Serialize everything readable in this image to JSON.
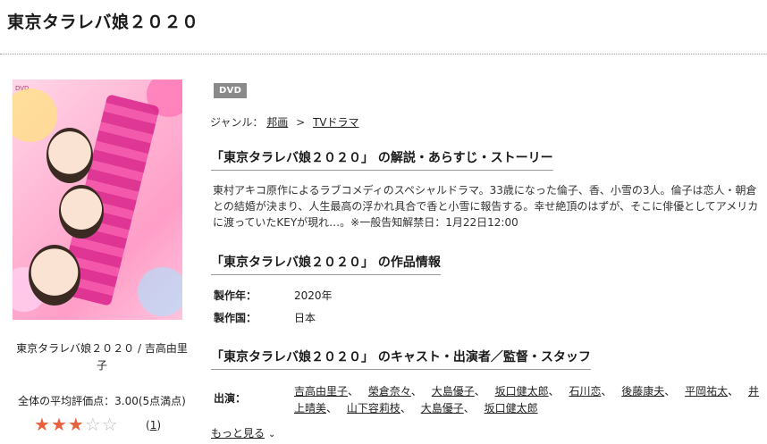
{
  "page_title": "東京タラレバ娘２０２０",
  "poster": {
    "caption": "東京タラレバ娘２０２０ / 吉高由里子",
    "average_rating_text": "全体の平均評価点：3.00(5点満点)",
    "rating": 3,
    "rating_max": 5,
    "review_count": "1"
  },
  "colors": {
    "star_on": "#e8603c",
    "star_off": "#bfbfbf",
    "badge_bg": "#8a8a8a",
    "poster_pink": "#ff9ec8"
  },
  "badge": "DVD",
  "breadcrumb": {
    "label": "ジャンル：",
    "items": [
      "邦画",
      "TVドラマ"
    ],
    "separator": ">"
  },
  "sections": {
    "story_heading": "「東京タラレバ娘２０２０」 の解説・あらすじ・ストーリー",
    "story_text": "東村アキコ原作によるラブコメディのスペシャルドラマ。33歳になった倫子、香、小雪の3人。倫子は恋人・朝倉との結婚が決まり、人生最高の浮かれ具合で香と小雪に報告する。幸せ絶頂のはずが、そこに俳優としてアメリカに渡っていたKEYが現れ…。※一般告知解禁日：1月22日12:00",
    "info_heading": "「東京タラレバ娘２０２０」 の作品情報",
    "info": [
      {
        "label": "製作年：",
        "value": "2020年"
      },
      {
        "label": "製作国：",
        "value": "日本"
      }
    ],
    "cast_heading": "「東京タラレバ娘２０２０」 のキャスト・出演者／監督・スタッフ",
    "cast_label": "出演：",
    "cast": [
      "吉高由里子",
      "榮倉奈々",
      "大島優子",
      "坂口健太郎",
      "石川恋",
      "後藤康夫",
      "平岡祐太",
      "井上晴美",
      "山下容莉枝",
      "大島優子",
      "坂口健太郎"
    ],
    "more_link": "もっと見る"
  },
  "icons": {
    "star": "★",
    "star_empty": "☆",
    "chevron": "chevron-down-icon"
  }
}
